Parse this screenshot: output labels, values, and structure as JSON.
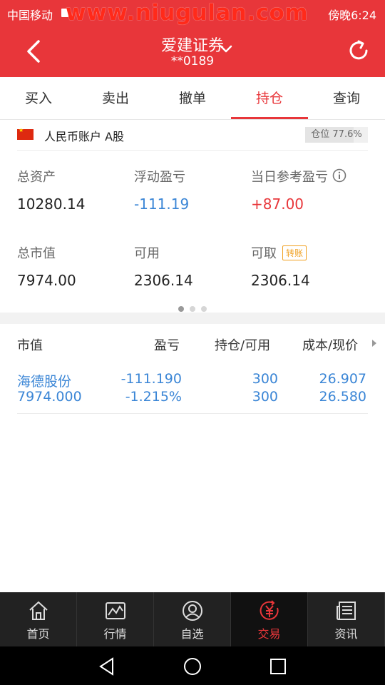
{
  "status_bar": {
    "carrier": "中国移动",
    "watermark": "www.niugulan.com",
    "time": "傍晚6:24"
  },
  "header": {
    "title": "爱建证券",
    "account": "**0189"
  },
  "tabs": [
    {
      "label": "买入"
    },
    {
      "label": "卖出"
    },
    {
      "label": "撤单"
    },
    {
      "label": "持仓",
      "active": true
    },
    {
      "label": "查询"
    }
  ],
  "account_row": {
    "name": "人民币账户 A股",
    "position_label": "仓位 77.6%",
    "position_ratio": 0.776
  },
  "summary": {
    "total_assets": {
      "label": "总资产",
      "value": "10280.14"
    },
    "floating_pl": {
      "label": "浮动盈亏",
      "value": "-111.19"
    },
    "daily_pl": {
      "label": "当日参考盈亏",
      "value": "+87.00"
    },
    "market_value": {
      "label": "总市值",
      "value": "7974.00"
    },
    "available": {
      "label": "可用",
      "value": "2306.14"
    },
    "withdrawable": {
      "label": "可取",
      "value": "2306.14",
      "badge": "转账"
    }
  },
  "pager": {
    "pages": 3,
    "current": 1
  },
  "holdings": {
    "headers": [
      "市值",
      "盈亏",
      "持仓/可用",
      "成本/现价"
    ],
    "rows": [
      {
        "name": "海德股份",
        "market_value": "7974.000",
        "pl": "-111.190",
        "pl_pct": "-1.215%",
        "position": "300",
        "available": "300",
        "cost": "26.907",
        "price": "26.580"
      }
    ]
  },
  "bottom_nav": [
    {
      "label": "首页",
      "icon": "home-icon"
    },
    {
      "label": "行情",
      "icon": "chart-icon"
    },
    {
      "label": "自选",
      "icon": "user-icon"
    },
    {
      "label": "交易",
      "icon": "yuan-icon",
      "active": true
    },
    {
      "label": "资讯",
      "icon": "news-icon"
    }
  ],
  "colors": {
    "brand_red": "#e8363a",
    "value_blue": "#3b86d6",
    "badge_orange": "#f0a020"
  }
}
